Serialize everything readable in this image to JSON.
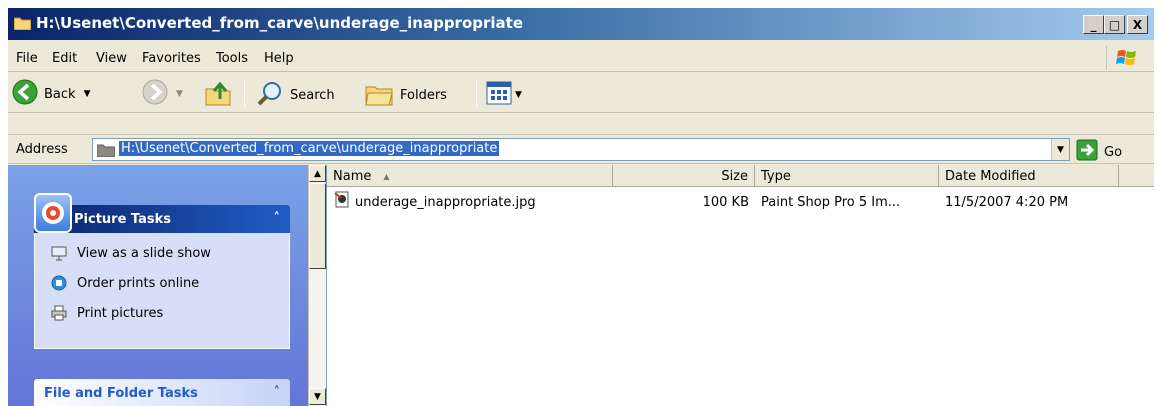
{
  "window": {
    "title": "H:\\Usenet\\Converted_from_carve\\underage_inappropriate",
    "minimize_label": "_",
    "maximize_label": "□",
    "close_label": "X"
  },
  "menubar": {
    "items": [
      "File",
      "Edit",
      "View",
      "Favorites",
      "Tools",
      "Help"
    ]
  },
  "toolbar": {
    "back_label": "Back",
    "search_label": "Search",
    "folders_label": "Folders"
  },
  "address": {
    "label": "Address",
    "value": "H:\\Usenet\\Converted_from_carve\\underage_inappropriate",
    "go_label": "Go"
  },
  "tasks": {
    "picture_title": "Picture Tasks",
    "picture_links": [
      "View as a slide show",
      "Order prints online",
      "Print pictures"
    ],
    "folder_title": "File and Folder Tasks",
    "chevron": "˄"
  },
  "filelist": {
    "columns": {
      "name": "Name",
      "size": "Size",
      "type": "Type",
      "date": "Date Modified"
    },
    "rows": [
      {
        "name": "underage_inappropriate.jpg",
        "size": "100 KB",
        "type": "Paint Shop Pro 5 Im...",
        "date": "11/5/2007 4:20 PM"
      }
    ]
  },
  "colors": {
    "title_bar": "#0a246a",
    "selection": "#316ac5",
    "task_pane": "#6375d6"
  }
}
